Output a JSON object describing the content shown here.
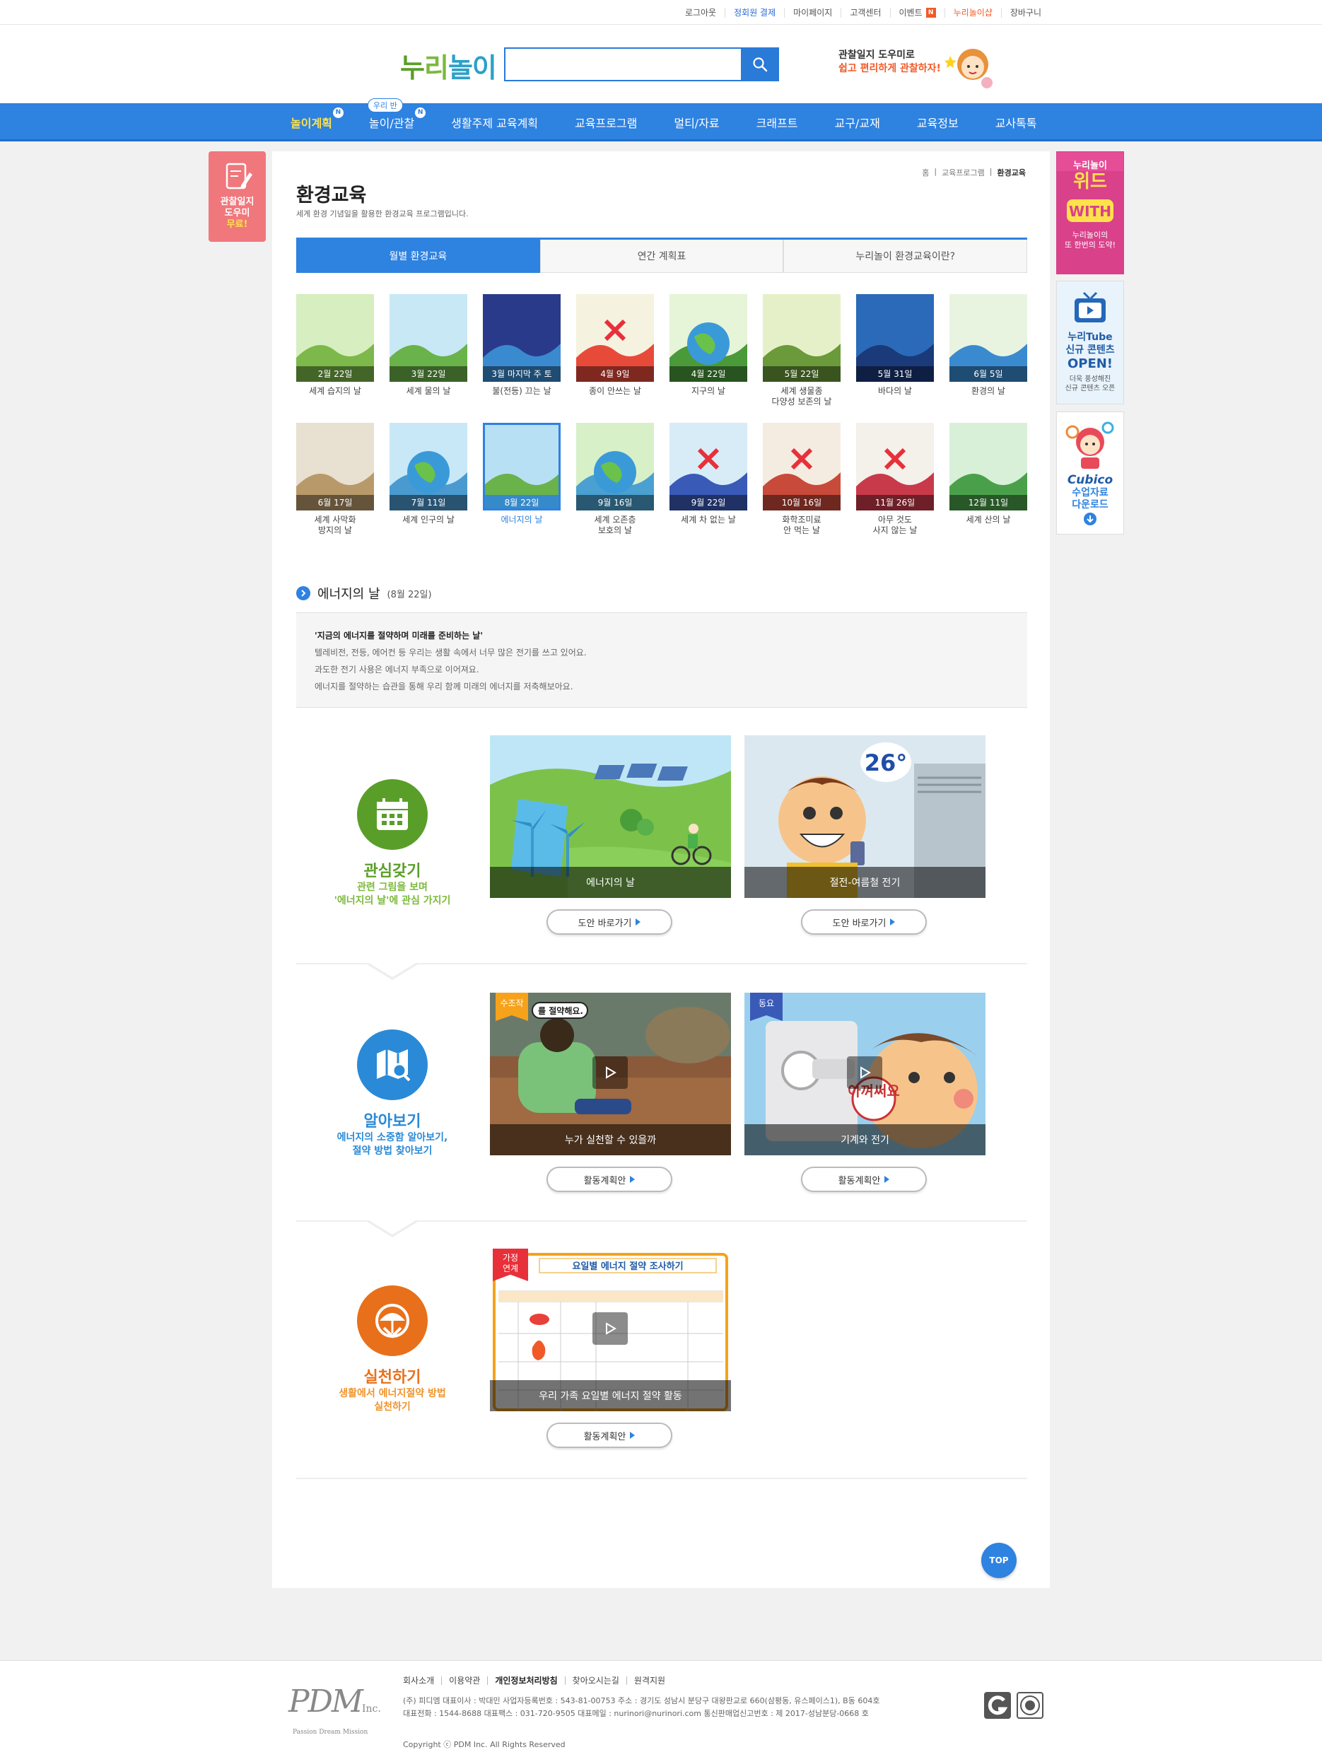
{
  "util_links": [
    {
      "label": "로그아웃",
      "style": ""
    },
    {
      "label": "정회원 결제",
      "style": "blue"
    },
    {
      "label": "마이페이지",
      "style": ""
    },
    {
      "label": "고객센터",
      "style": ""
    },
    {
      "label": "이벤트",
      "style": "",
      "badge": "N"
    },
    {
      "label": "누리놀이샵",
      "style": "orange"
    },
    {
      "label": "장바구니",
      "style": ""
    }
  ],
  "logo": {
    "p1": "누",
    "p2": "리",
    "p3": "놀이"
  },
  "search": {
    "placeholder": ""
  },
  "promo": {
    "line1": "관찰일지 도우미로",
    "line2": "쉽고 편리하게 관찰하자!"
  },
  "nav": [
    {
      "label": "놀이계획",
      "badge": "N",
      "active": true
    },
    {
      "label": "놀이/관찰",
      "badge": "N",
      "bubble": "우리 반"
    },
    {
      "label": "생활주제 교육계획"
    },
    {
      "label": "교육프로그램"
    },
    {
      "label": "멀티/자료"
    },
    {
      "label": "크래프트"
    },
    {
      "label": "교구/교재"
    },
    {
      "label": "교육정보"
    },
    {
      "label": "교사톡톡"
    }
  ],
  "breadcrumb": {
    "home": "홈",
    "cat": "교육프로그램",
    "current": "환경교육"
  },
  "page": {
    "title": "환경교육",
    "desc": "세계 환경 기념일을 활용한 환경교육 프로그램입니다."
  },
  "tabs": [
    "월별 환경교육",
    "연간 계획표",
    "누리놀이 환경교육이란?"
  ],
  "months": [
    {
      "date": "2월 22일",
      "name": "세계 습지의 날"
    },
    {
      "date": "3월 22일",
      "name": "세계 물의 날"
    },
    {
      "date": "3월 마지막 주 토",
      "name": "불(전등) 끄는 날"
    },
    {
      "date": "4월 9일",
      "name": "종이 안쓰는 날"
    },
    {
      "date": "4월 22일",
      "name": "지구의 날"
    },
    {
      "date": "5월 22일",
      "name": "세계 생물종\n다양성 보존의 날"
    },
    {
      "date": "5월 31일",
      "name": "바다의 날"
    },
    {
      "date": "6월 5일",
      "name": "환경의 날"
    },
    {
      "date": "6월 17일",
      "name": "세계 사막화\n방지의 날"
    },
    {
      "date": "7월 11일",
      "name": "세계 인구의 날"
    },
    {
      "date": "8월 22일",
      "name": "에너지의 날"
    },
    {
      "date": "9월 16일",
      "name": "세계 오존층\n보호의 날"
    },
    {
      "date": "9월 22일",
      "name": "세계 차 없는 날"
    },
    {
      "date": "10월 16일",
      "name": "화학조미료\n안 먹는 날"
    },
    {
      "date": "11월 26일",
      "name": "아무 것도\n사지 않는 날"
    },
    {
      "date": "12월 11일",
      "name": "세계 산의 날"
    }
  ],
  "section": {
    "title": "에너지의 날",
    "date": "(8월 22일)"
  },
  "intro": {
    "headline": "'지금의 에너지를 절약하며 미래를 준비하는 날'",
    "line1": "텔레비전, 전등, 에어컨 등 우리는 생활 속에서 너무 많은 전기를 쓰고 있어요.",
    "line2": "과도한 전기 사용은 에너지 부족으로 이어져요.",
    "line3": "에너지를 절약하는 습관을 통해 우리 함께 미래의 에너지를 저축해보아요."
  },
  "steps": [
    {
      "name": "관심갖기",
      "desc1": "관련 그림을 보며",
      "desc2": "'에너지의 날'에 관심 가지기",
      "color": "#5a9e2a",
      "descColor": "#7cb93c",
      "cards": [
        {
          "caption": "에너지의 날",
          "button": "도안 바로가기"
        },
        {
          "caption": "절전-여름철 전기",
          "button": "도안 바로가기",
          "temp": "26°"
        }
      ]
    },
    {
      "name": "알아보기",
      "desc1": "에너지의 소중함 알아보기,",
      "desc2": "절약 방법 찾아보기",
      "color": "#2a8ad7",
      "descColor": "#2a8ad7",
      "cards": [
        {
          "caption": "누가 실천할 수 있을까",
          "button": "활동계획안",
          "tag": "수조작",
          "speech": "를 절약해요."
        },
        {
          "caption": "기계와 전기",
          "button": "활동계획안",
          "tag": "동요",
          "speech": "아껴써요"
        }
      ]
    },
    {
      "name": "실천하기",
      "desc1": "생활에서 에너지절약 방법",
      "desc2": "실천하기",
      "color": "#e8701a",
      "descColor": "#f0942a",
      "cards": [
        {
          "caption": "우리 가족 요일별 에너지 절약 활동",
          "button": "활동계획안",
          "tag": "가정\n연계",
          "sheet_title": "요일별 에너지 절약 조사하기"
        }
      ]
    }
  ],
  "top_label": "TOP",
  "left_banner": {
    "line1": "관찰일지",
    "line2": "도우미",
    "line3": "무료!"
  },
  "right_banners": [
    {
      "top": "누리놀이",
      "title": "위드",
      "sub1": "누리놀이의",
      "sub2": "또 한번의 도약!"
    },
    {
      "title1": "누리Tube",
      "title2": "신규 콘텐츠",
      "title3": "OPEN!",
      "sub1": "더욱 풍성해진",
      "sub2": "신규 콘텐츠 오픈"
    },
    {
      "brand": "Cubico",
      "line1": "수업자료",
      "line2": "다운로드"
    }
  ],
  "footer": {
    "links": [
      {
        "label": "회사소개",
        "bold": false
      },
      {
        "label": "이용약관",
        "bold": false
      },
      {
        "label": "개인정보처리방침",
        "bold": true
      },
      {
        "label": "찾아오시는길",
        "bold": false
      },
      {
        "label": "원격지원",
        "bold": false
      }
    ],
    "info1": "(주) 피디엠 대표이사 : 박대민 사업자등록번호 : 543-81-00753 주소 : 경기도 성남시 분당구 대왕판교로 660(삼평동, 유스페이스1), B동 604호",
    "info2": "대표전화 : 1544-8688 대표팩스 : 031-720-9505 대표메일 : nurinori@nurinori.com 통신판매업신고번호 : 제 2017-성남분당-0668 호",
    "copyright": "Copyright ⓒ PDM Inc. All Rights Reserved",
    "logo": "PDM",
    "logo_inc": "Inc.",
    "logo_tag": "Passion Dream Mission"
  }
}
